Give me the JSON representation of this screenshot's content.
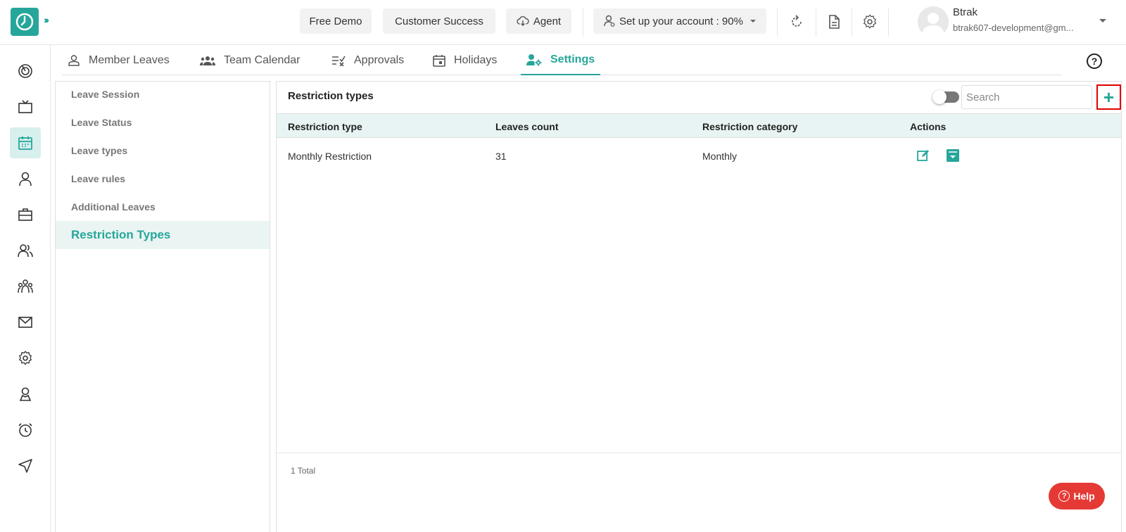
{
  "header": {
    "buttons": {
      "free_demo": "Free Demo",
      "customer_success": "Customer Success",
      "agent": "Agent",
      "setup_account": "Set up your account : 90%"
    },
    "user": {
      "name": "Btrak",
      "email": "btrak607-development@gm..."
    }
  },
  "tabs": [
    {
      "label": "Member Leaves"
    },
    {
      "label": "Team Calendar"
    },
    {
      "label": "Approvals"
    },
    {
      "label": "Holidays"
    },
    {
      "label": "Settings",
      "active": true
    }
  ],
  "sidebar": {
    "items": [
      {
        "label": "Leave Session"
      },
      {
        "label": "Leave Status"
      },
      {
        "label": "Leave types"
      },
      {
        "label": "Leave rules"
      },
      {
        "label": "Additional Leaves"
      },
      {
        "label": "Restriction Types",
        "active": true
      }
    ]
  },
  "main": {
    "title": "Restriction types",
    "search_placeholder": "Search",
    "add_label": "+",
    "columns": [
      "Restriction type",
      "Leaves count",
      "Restriction category",
      "Actions"
    ],
    "rows": [
      {
        "restriction_type": "Monthly Restriction",
        "leaves_count": "31",
        "restriction_category": "Monthly"
      }
    ],
    "total": "1 Total"
  },
  "help": {
    "label": "Help"
  },
  "colors": {
    "accent": "#26a69a",
    "highlight_border": "#e00000",
    "help_button": "#e53935"
  }
}
